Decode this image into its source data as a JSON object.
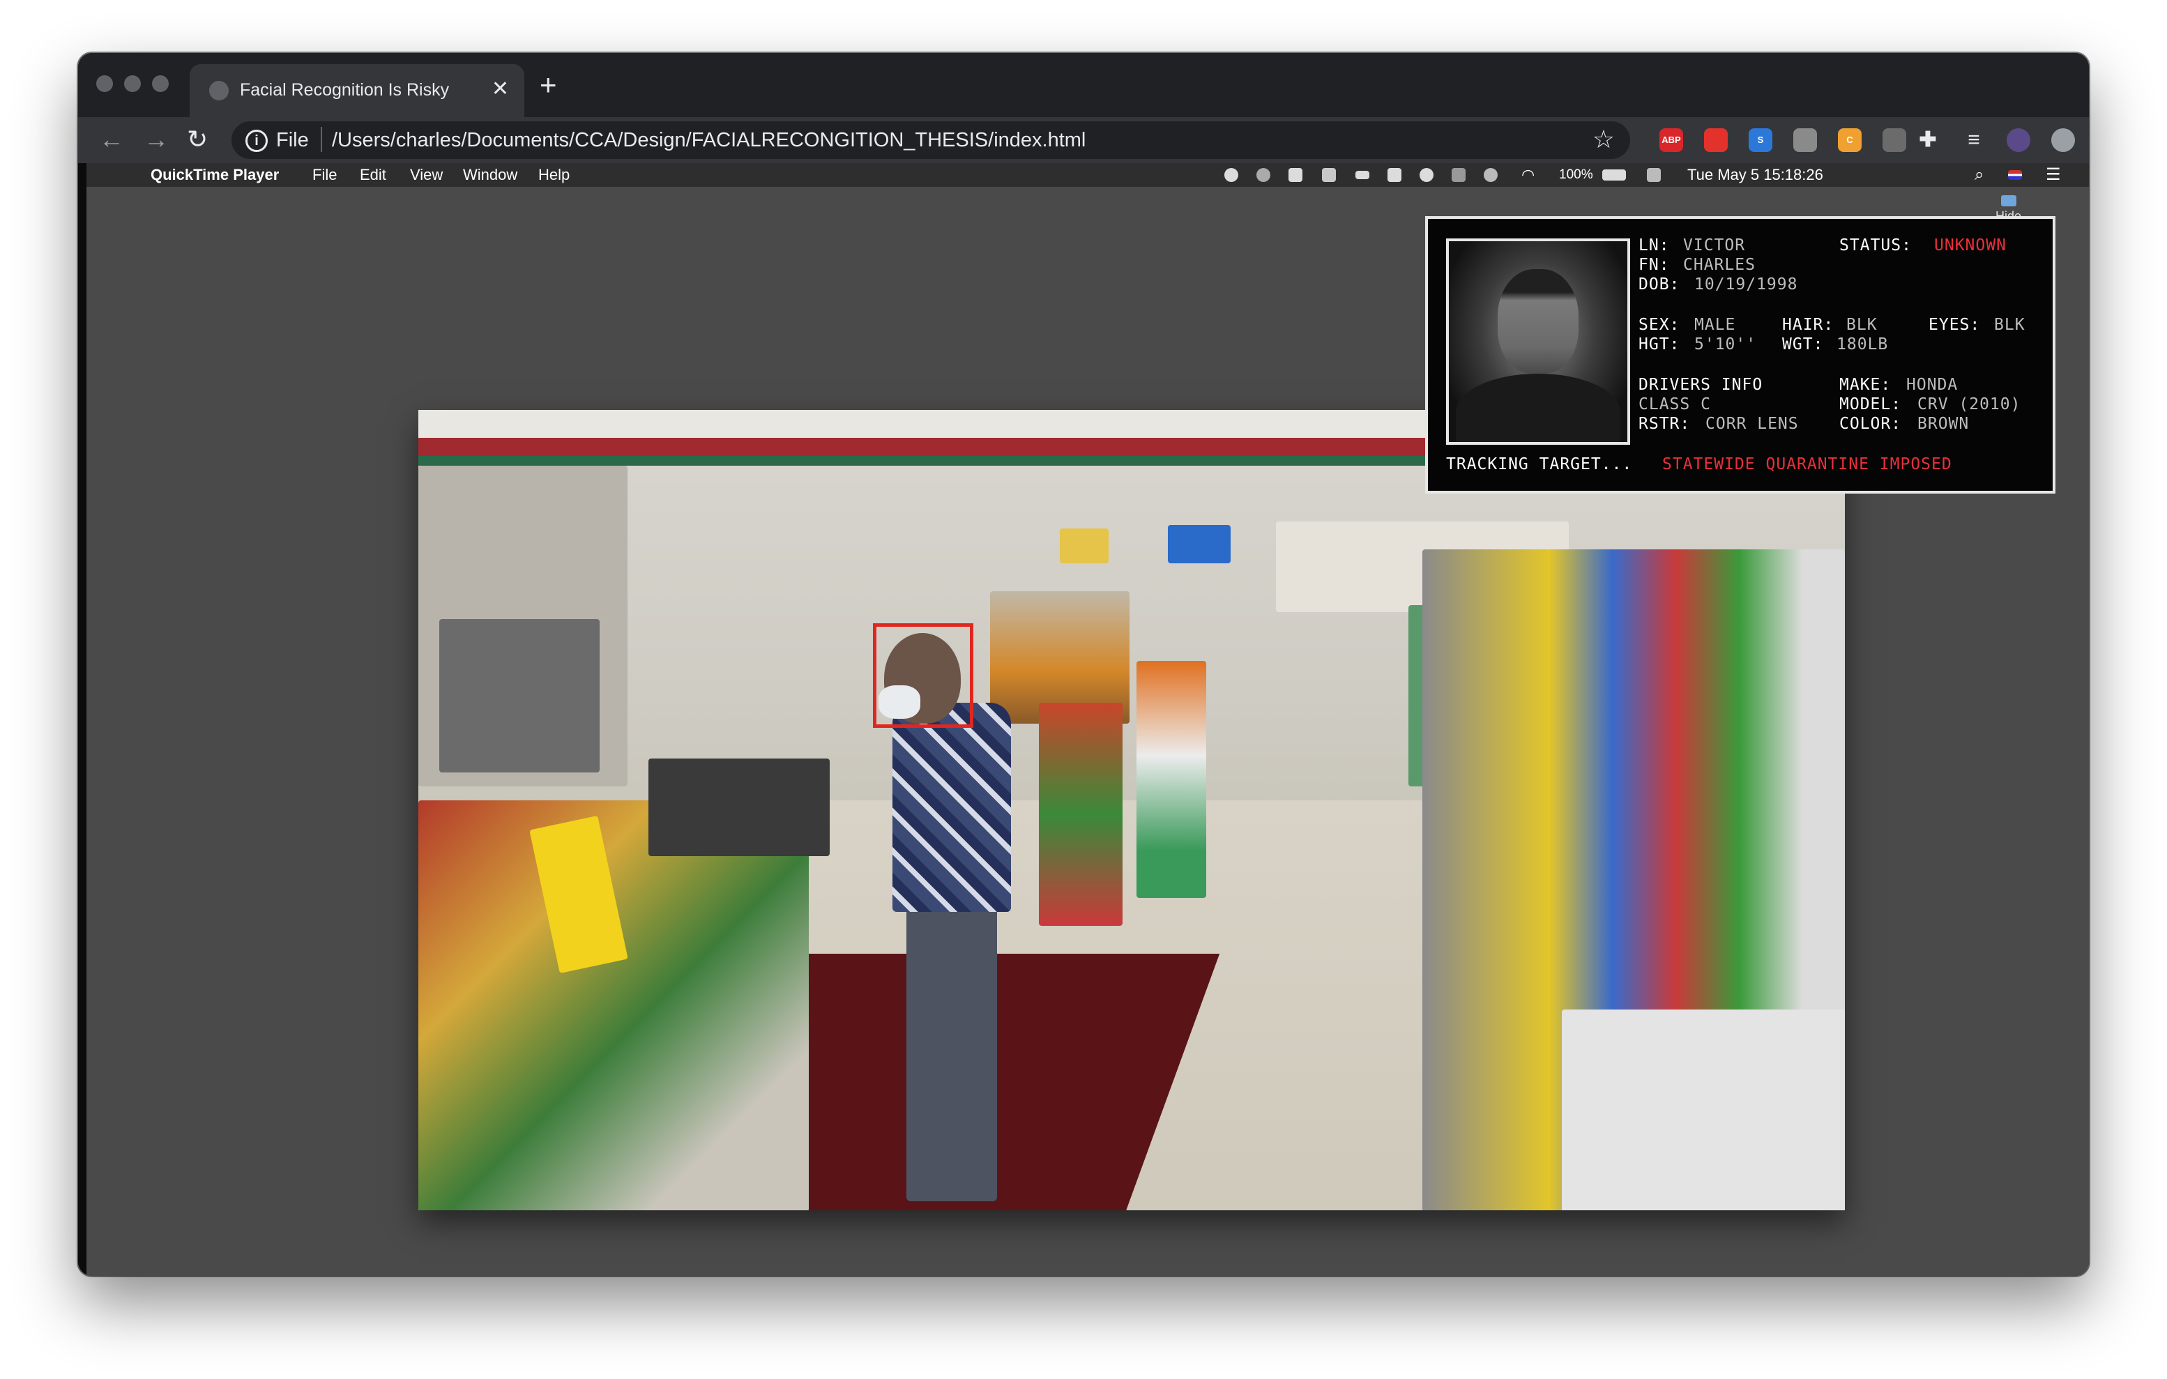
{
  "browser": {
    "tab_title": "Facial Recognition Is Risky",
    "url_scheme": "File",
    "url_path": "/Users/charles/Documents/CCA/Design/FACIALRECONGITION_THESIS/index.html",
    "extensions": [
      {
        "name": "adblock-icon",
        "label": "ABP",
        "color": "#d9262b"
      },
      {
        "name": "red-extension-icon",
        "label": "",
        "color": "#e3322b"
      },
      {
        "name": "blue-s-extension-icon",
        "label": "S",
        "color": "#2b78d9"
      },
      {
        "name": "car-extension-icon",
        "label": "",
        "color": "#8a8a8a"
      },
      {
        "name": "orange-c-extension-icon",
        "label": "C",
        "color": "#f0a030"
      },
      {
        "name": "gray-extension-icon",
        "label": "",
        "color": "#6b6b6b"
      }
    ]
  },
  "menubar": {
    "app": "QuickTime Player",
    "menus": [
      "File",
      "Edit",
      "View",
      "Window",
      "Help"
    ],
    "battery": "100%",
    "clock": "Tue May 5  15:18:26"
  },
  "hide_label": "Hide",
  "idcard": {
    "ln_label": "LN:",
    "ln": "VICTOR",
    "fn_label": "FN:",
    "fn": "CHARLES",
    "dob_label": "DOB:",
    "dob": "10/19/1998",
    "status_label": "STATUS:",
    "status": "UNKNOWN",
    "sex_label": "SEX:",
    "sex": "MALE",
    "hgt_label": "HGT:",
    "hgt": "5'10''",
    "hair_label": "HAIR:",
    "hair": "BLK",
    "wgt_label": "WGT:",
    "wgt": "180LB",
    "eyes_label": "EYES:",
    "eyes": "BLK",
    "drivers_label": "DRIVERS INFO",
    "class": "CLASS C",
    "rstr_label": "RSTR:",
    "rstr": "CORR LENS",
    "make_label": "MAKE:",
    "make": "HONDA",
    "model_label": "MODEL:",
    "model": "CRV (2010)",
    "color_label": "COLOR:",
    "color": "BROWN",
    "tracking": "TRACKING TARGET...",
    "alert": "STATEWIDE QUARANTINE IMPOSED"
  },
  "colors": {
    "alert_red": "#e8303a",
    "face_box": "#e0271f"
  }
}
